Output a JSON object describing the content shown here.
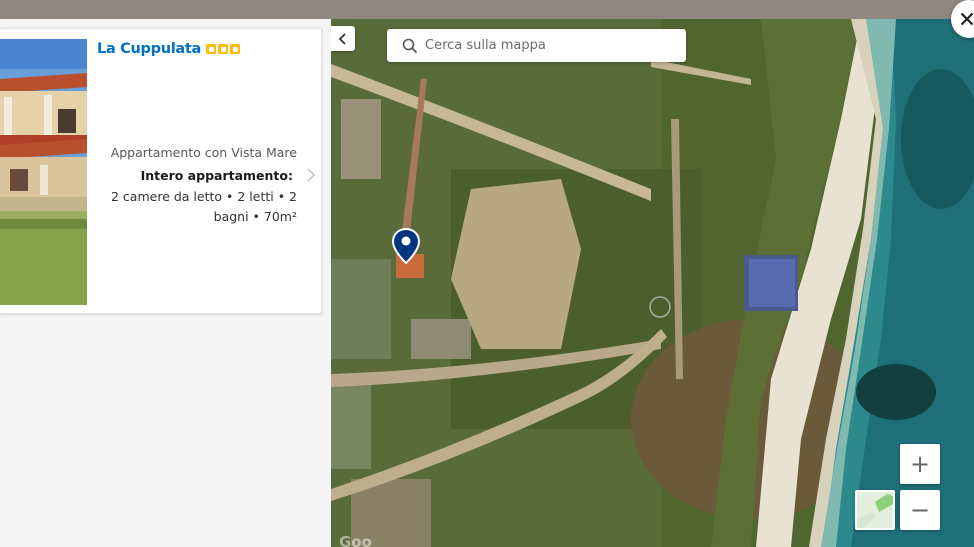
{
  "property": {
    "name": "La Cuppulata",
    "rating_squares": 3,
    "room_name": "Appartamento con Vista Mare",
    "unit_type": "Intero appartamento:",
    "unit_details": "2 camere da letto • 2 letti • 2 bagni • 70m²"
  },
  "map": {
    "search_placeholder": "Cerca sulla mappa",
    "zoom_in_label": "+",
    "zoom_out_label": "−",
    "attribution": "Goo"
  },
  "colors": {
    "brand_blue": "#0071c2",
    "rating_yellow": "#febb02",
    "pin_blue": "#003580"
  },
  "icons": {
    "collapse": "chevron-left-icon",
    "search": "search-icon",
    "next": "chevron-right-icon",
    "close": "close-icon",
    "pin": "map-pin-icon"
  }
}
